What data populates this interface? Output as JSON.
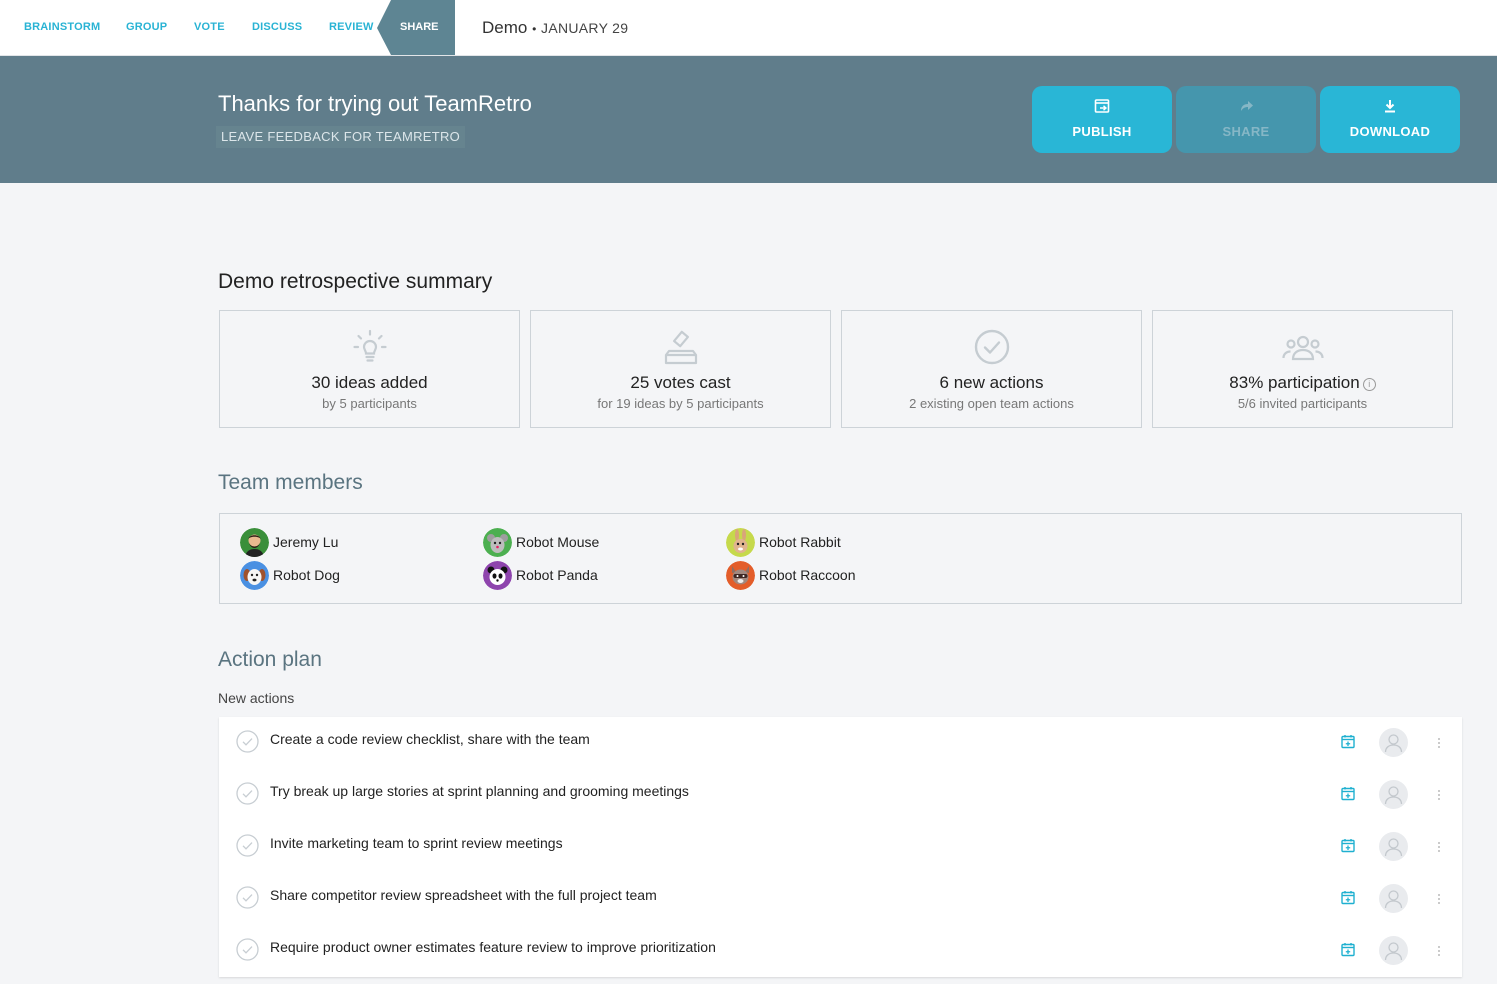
{
  "nav": {
    "steps": [
      "BRAINSTORM",
      "GROUP",
      "VOTE",
      "DISCUSS",
      "REVIEW"
    ],
    "active_step": "SHARE",
    "session_name": "Demo",
    "separator": "•",
    "session_date": "JANUARY 29"
  },
  "banner": {
    "title": "Thanks for trying out TeamRetro",
    "feedback_link": "LEAVE FEEDBACK FOR TEAMRETRO",
    "buttons": [
      {
        "label": "PUBLISH",
        "icon": "publish-icon",
        "enabled": true
      },
      {
        "label": "SHARE",
        "icon": "share-arrow-icon",
        "enabled": false
      },
      {
        "label": "DOWNLOAD",
        "icon": "download-icon",
        "enabled": true
      }
    ],
    "accent": "#29b6d6",
    "background": "#607d8b"
  },
  "summary": {
    "title": "Demo retrospective summary",
    "cards": [
      {
        "icon": "lightbulb-icon",
        "main": "30 ideas added",
        "sub": "by 5 participants"
      },
      {
        "icon": "ballot-box-icon",
        "main": "25 votes cast",
        "sub": "for 19 ideas by 5 participants"
      },
      {
        "icon": "check-circle-icon",
        "main": "6 new actions",
        "sub": "2 existing open team actions"
      },
      {
        "icon": "people-icon",
        "main": "83% participation",
        "sub": "5/6 invited participants",
        "info": "i"
      }
    ]
  },
  "team": {
    "title": "Team members",
    "members": [
      {
        "name": "Jeremy Lu",
        "avatar": "avatar-jeremy",
        "color": "#3a8f3a"
      },
      {
        "name": "Robot Mouse",
        "avatar": "avatar-mouse",
        "color": "#4caf50"
      },
      {
        "name": "Robot Rabbit",
        "avatar": "avatar-rabbit",
        "color": "#c6d94c"
      },
      {
        "name": "Robot Dog",
        "avatar": "avatar-dog",
        "color": "#4a90e2"
      },
      {
        "name": "Robot Panda",
        "avatar": "avatar-panda",
        "color": "#8e44ad"
      },
      {
        "name": "Robot Raccoon",
        "avatar": "avatar-raccoon",
        "color": "#e35d2a"
      }
    ]
  },
  "action_plan": {
    "title": "Action plan",
    "subtitle": "New actions",
    "actions": [
      "Create a code review checklist, share with the team",
      "Try break up large stories at sprint planning and grooming meetings",
      "Invite marketing team to sprint review meetings",
      "Share competitor review spreadsheet with the full project team",
      "Require product owner estimates feature review to improve prioritization"
    ]
  }
}
